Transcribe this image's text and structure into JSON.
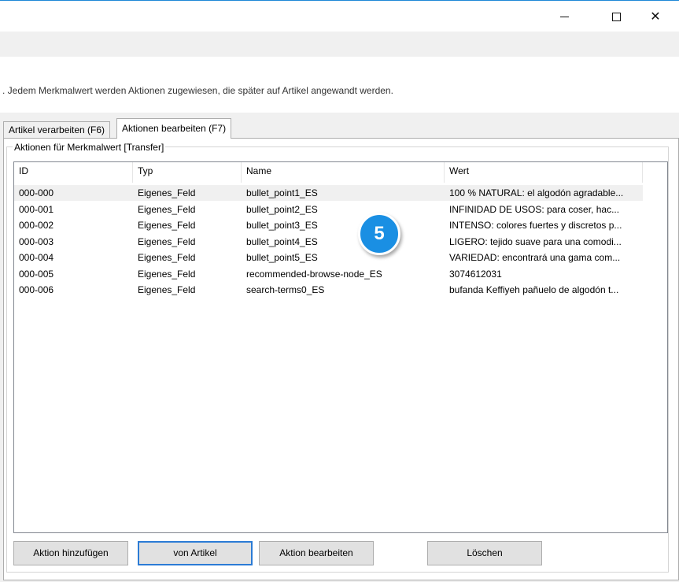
{
  "window": {
    "minimize_symbol": "",
    "maximize_symbol": "",
    "close_symbol": "✕"
  },
  "description": ". Jedem Merkmalwert werden Aktionen zugewiesen, die später auf Artikel angewandt werden.",
  "tabs": [
    {
      "label": "Artikel verarbeiten (F6)",
      "active": false
    },
    {
      "label": "Aktionen bearbeiten (F7)",
      "active": true
    }
  ],
  "group": {
    "title": "Aktionen für Merkmalwert [Transfer]"
  },
  "table": {
    "columns": [
      "ID",
      "Typ",
      "Name",
      "Wert"
    ],
    "rows": [
      {
        "id": "000-000",
        "typ": "Eigenes_Feld",
        "name": "bullet_point1_ES",
        "wert": "100 % NATURAL: el algodón agradable..."
      },
      {
        "id": "000-001",
        "typ": "Eigenes_Feld",
        "name": "bullet_point2_ES",
        "wert": "INFINIDAD DE USOS: para coser, hac..."
      },
      {
        "id": "000-002",
        "typ": "Eigenes_Feld",
        "name": "bullet_point3_ES",
        "wert": "INTENSO: colores fuertes y discretos p..."
      },
      {
        "id": "000-003",
        "typ": "Eigenes_Feld",
        "name": "bullet_point4_ES",
        "wert": "LIGERO: tejido suave para una comodi..."
      },
      {
        "id": "000-004",
        "typ": "Eigenes_Feld",
        "name": "bullet_point5_ES",
        "wert": "VARIEDAD: encontrará una gama com..."
      },
      {
        "id": "000-005",
        "typ": "Eigenes_Feld",
        "name": "recommended-browse-node_ES",
        "wert": "3074612031"
      },
      {
        "id": "000-006",
        "typ": "Eigenes_Feld",
        "name": "search-terms0_ES",
        "wert": "bufanda Keffiyeh pañuelo de algodón t..."
      }
    ],
    "selected_row": 0
  },
  "badge": {
    "number": "5",
    "color": "#1a8fe3"
  },
  "buttons": {
    "add": "Aktion hinzufügen",
    "from_article": "von Artikel",
    "edit": "Aktion bearbeiten",
    "delete": "Löschen"
  }
}
